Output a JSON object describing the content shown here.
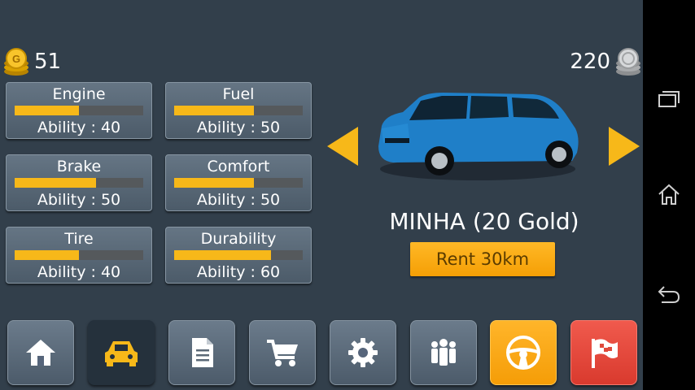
{
  "currency": {
    "gold": "51",
    "silver": "220"
  },
  "stats": [
    {
      "title": "Engine",
      "ability": "Ability : 40",
      "level": 0.5
    },
    {
      "title": "Fuel",
      "ability": "Ability : 50",
      "level": 0.62
    },
    {
      "title": "Brake",
      "ability": "Ability : 50",
      "level": 0.63
    },
    {
      "title": "Comfort",
      "ability": "Ability : 50",
      "level": 0.62
    },
    {
      "title": "Tire",
      "ability": "Ability : 40",
      "level": 0.5
    },
    {
      "title": "Durability",
      "ability": "Ability : 60",
      "level": 0.75
    }
  ],
  "car": {
    "name": "MINHA (20 Gold)",
    "rent_label": "Rent 30km",
    "color": "#1f7fc8"
  },
  "menu": [
    {
      "icon": "home-icon"
    },
    {
      "icon": "car-icon"
    },
    {
      "icon": "document-icon"
    },
    {
      "icon": "cart-icon"
    },
    {
      "icon": "gear-icon"
    },
    {
      "icon": "people-icon"
    },
    {
      "icon": "steering-wheel-icon"
    },
    {
      "icon": "flag-icon"
    }
  ],
  "colors": {
    "accent": "#f7b819",
    "danger": "#e04a3c",
    "background": "#323f4b"
  }
}
